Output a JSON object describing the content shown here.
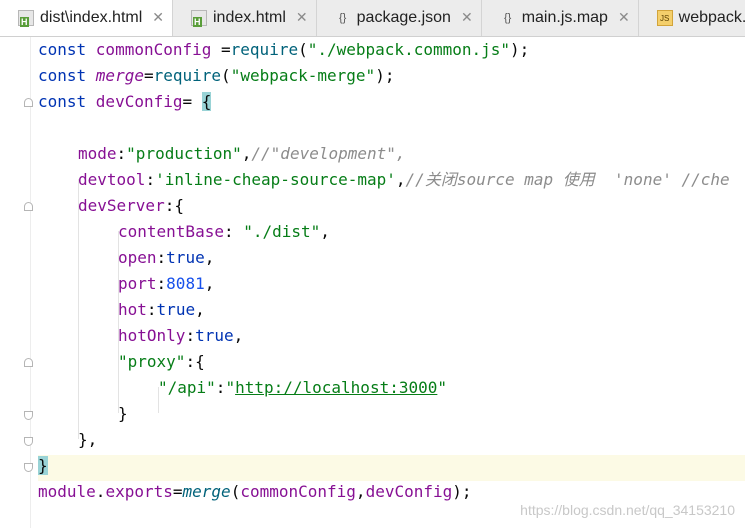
{
  "tabs": [
    {
      "label": "dist\\index.html",
      "icon": "html-file-icon",
      "active": true
    },
    {
      "label": "index.html",
      "icon": "html-file-icon",
      "active": false
    },
    {
      "label": "package.json",
      "icon": "json-file-icon",
      "active": false
    },
    {
      "label": "main.js.map",
      "icon": "json-file-icon",
      "active": false
    },
    {
      "label": "webpack.co",
      "icon": "js-file-icon",
      "active": false
    }
  ],
  "close_glyph": "✕",
  "code": {
    "l1": {
      "a": "const ",
      "b": "commonConfig",
      "c": " =",
      "d": "require",
      "e": "(",
      "f": "\"./webpack.common.js\"",
      "g": ");"
    },
    "l2": {
      "a": "const ",
      "b": "merge",
      "c": "=",
      "d": "require",
      "e": "(",
      "f": "\"webpack-merge\"",
      "g": ");"
    },
    "l3": {
      "a": "const ",
      "b": "devConfig",
      "c": "= ",
      "d": "{"
    },
    "l5": {
      "a": "mode",
      "b": ":",
      "c": "\"production\"",
      "d": ",",
      "e": "//\"development\","
    },
    "l6": {
      "a": "devtool",
      "b": ":",
      "c": "'inline-cheap-source-map'",
      "d": ",",
      "e": "//关闭source map 使用  'none' //che"
    },
    "l7": {
      "a": "devServer",
      "b": ":{"
    },
    "l8": {
      "a": "contentBase",
      "b": ": ",
      "c": "\"./dist\"",
      "d": ","
    },
    "l9": {
      "a": "open",
      "b": ":",
      "c": "true",
      "d": ","
    },
    "l10": {
      "a": "port",
      "b": ":",
      "c": "8081",
      "d": ","
    },
    "l11": {
      "a": "hot",
      "b": ":",
      "c": "true",
      "d": ","
    },
    "l12": {
      "a": "hotOnly",
      "b": ":",
      "c": "true",
      "d": ","
    },
    "l13": {
      "a": "\"proxy\"",
      "b": ":{"
    },
    "l14": {
      "a": "\"/api\"",
      "b": ":",
      "c": "\"",
      "d": "http://localhost:3000",
      "e": "\""
    },
    "l15": {
      "a": "}"
    },
    "l16": {
      "a": "},"
    },
    "l17": {
      "a": "}"
    },
    "l18": {
      "a": "module",
      "b": ".",
      "c": "exports",
      "d": "=",
      "e": "merge",
      "f": "(",
      "g": "commonConfig",
      "h": ",",
      "i": "devConfig",
      "j": ");"
    }
  },
  "watermark": "https://blog.csdn.net/qq_34153210",
  "colors": {
    "keyword": "#0033b3",
    "property": "#871094",
    "string": "#067d17",
    "number": "#1750eb",
    "comment": "#8c8c8c",
    "function": "#00627a",
    "current_line": "#fcfae5",
    "brace_match": "#99d3d6"
  }
}
